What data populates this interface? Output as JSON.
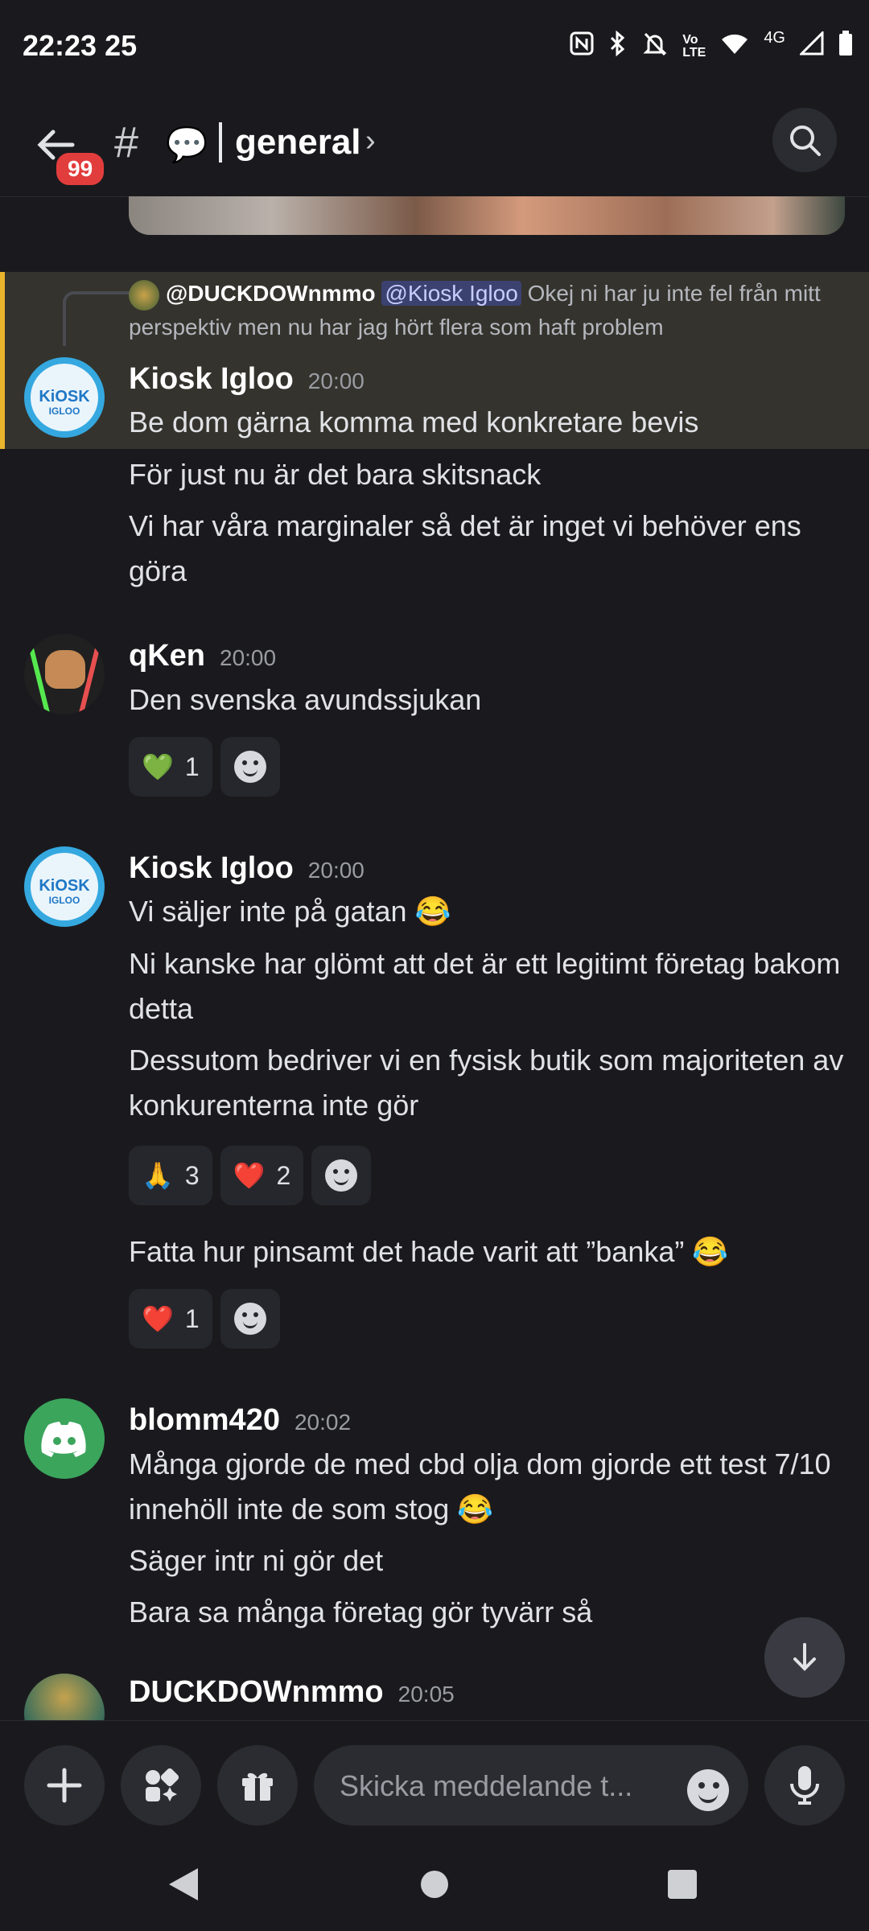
{
  "status_bar": {
    "time": "22:23",
    "extra": "25",
    "network": "4G",
    "volte": "Vo\nLTE"
  },
  "header": {
    "badge": "99",
    "hash": "#",
    "channel_emoji": "💬",
    "channel_name": "general",
    "chevron": "›"
  },
  "reply_preview": {
    "user": "@DUCKDOWnmmo",
    "mention": "@Kiosk Igloo",
    "text": "Okej ni har ju inte fel från mitt perspektiv men nu har jag hört flera som haft problem"
  },
  "messages": [
    {
      "user": "Kiosk Igloo",
      "time": "20:00",
      "avatar_text": "KiOSK",
      "avatar_sub": "IGLOO",
      "lines": [
        "Be dom gärna komma med konkretare bevis",
        "För just nu är det bara skitsnack",
        "Vi har våra marginaler så det är inget vi behöver ens göra"
      ]
    },
    {
      "user": "qKen",
      "time": "20:00",
      "lines": [
        "Den svenska avundssjukan"
      ],
      "reactions": [
        {
          "emoji": "💚",
          "count": "1"
        }
      ]
    },
    {
      "user": "Kiosk Igloo",
      "time": "20:00",
      "lines": [
        "Vi säljer inte på gatan 😂",
        "Ni kanske har glömt att det är ett legitimt företag bakom detta",
        "Dessutom bedriver vi en fysisk butik som majoriteten av konkurenterna inte gör"
      ],
      "reactions": [
        {
          "emoji": "🙏",
          "count": "3"
        },
        {
          "emoji": "❤️",
          "count": "2"
        }
      ],
      "followup": "Fatta hur pinsamt det hade varit att ”banka” 😂",
      "followup_reactions": [
        {
          "emoji": "❤️",
          "count": "1"
        }
      ]
    },
    {
      "user": "blomm420",
      "time": "20:02",
      "lines": [
        "Många gjorde de med cbd olja dom gjorde ett test 7/10 innehöll inte de som stog 😂",
        "Säger intr ni gör det",
        "Bara sa många företag gör tyvärr så"
      ]
    },
    {
      "user": "DUCKDOWnmmo",
      "time": "20:05"
    }
  ],
  "composer": {
    "placeholder": "Skicka meddelande t..."
  },
  "icons": {
    "back": "arrow-left-icon",
    "search": "search-icon",
    "scroll": "arrow-down-icon",
    "plus": "plus-icon",
    "apps": "apps-icon",
    "gift": "gift-icon",
    "mic": "microphone-icon"
  }
}
